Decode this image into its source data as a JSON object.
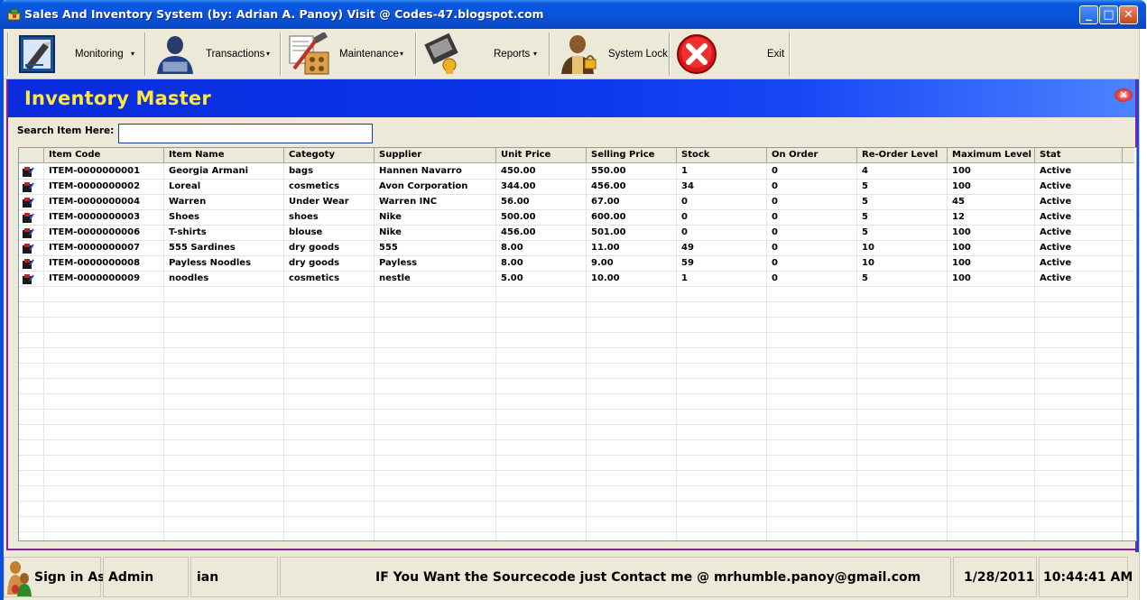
{
  "window": {
    "title": "Sales And Inventory System (by: Adrian A. Panoy) Visit @ Codes-47.blogspot.com"
  },
  "toolbar": {
    "monitoring": "Monitoring",
    "transactions": "Transactions",
    "maintenance": "Maintenance",
    "reports": "Reports",
    "system_lock": "System Lock",
    "exit": "Exit",
    "dropdown_arrow": "▾"
  },
  "form": {
    "title": "Inventory Master",
    "search_label": "Search Item Here:",
    "search_value": "",
    "close_glyph": "✕"
  },
  "grid": {
    "columns": [
      "Item Code",
      "Item Name",
      "Categoty",
      "Supplier",
      "Unit Price",
      "Selling Price",
      "Stock",
      "On Order",
      "Re-Order Level",
      "Maximum Level",
      "Stat"
    ],
    "rows": [
      [
        "ITEM-0000000001",
        "Georgia Armani",
        "bags",
        "Hannen Navarro",
        "450.00",
        "550.00",
        "1",
        "0",
        "4",
        "100",
        "Active"
      ],
      [
        "ITEM-0000000002",
        "Loreal",
        "cosmetics",
        "Avon Corporation",
        "344.00",
        "456.00",
        "34",
        "0",
        "5",
        "100",
        "Active"
      ],
      [
        "ITEM-0000000004",
        "Warren",
        "Under Wear",
        "Warren INC",
        "56.00",
        "67.00",
        "0",
        "0",
        "5",
        "45",
        "Active"
      ],
      [
        "ITEM-0000000003",
        "Shoes",
        "shoes",
        "Nike",
        "500.00",
        "600.00",
        "0",
        "0",
        "5",
        "12",
        "Active"
      ],
      [
        "ITEM-0000000006",
        "T-shirts",
        "blouse",
        "Nike",
        "456.00",
        "501.00",
        "0",
        "0",
        "5",
        "100",
        "Active"
      ],
      [
        "ITEM-0000000007",
        "555 Sardines",
        "dry goods",
        "555",
        "8.00",
        "11.00",
        "49",
        "0",
        "10",
        "100",
        "Active"
      ],
      [
        "ITEM-0000000008",
        "Payless Noodles",
        "dry goods",
        "Payless",
        "8.00",
        "9.00",
        "59",
        "0",
        "10",
        "100",
        "Active"
      ],
      [
        "ITEM-0000000009",
        "noodles",
        "cosmetics",
        "nestle",
        "5.00",
        "10.00",
        "1",
        "0",
        "5",
        "100",
        "Active"
      ]
    ]
  },
  "statusbar": {
    "sign_in_label": "Sign in As:",
    "role": "Admin",
    "user": "ian",
    "message": "IF You Want the Sourcecode just Contact me @ mrhumble.panoy@gmail.com",
    "date": "1/28/2011",
    "time": "10:44:41 AM"
  },
  "colors": {
    "titlebar": "#0a52d8",
    "banner": "#0a2cdc",
    "form_title": "#ffe83b",
    "chrome": "#ece9d8"
  }
}
